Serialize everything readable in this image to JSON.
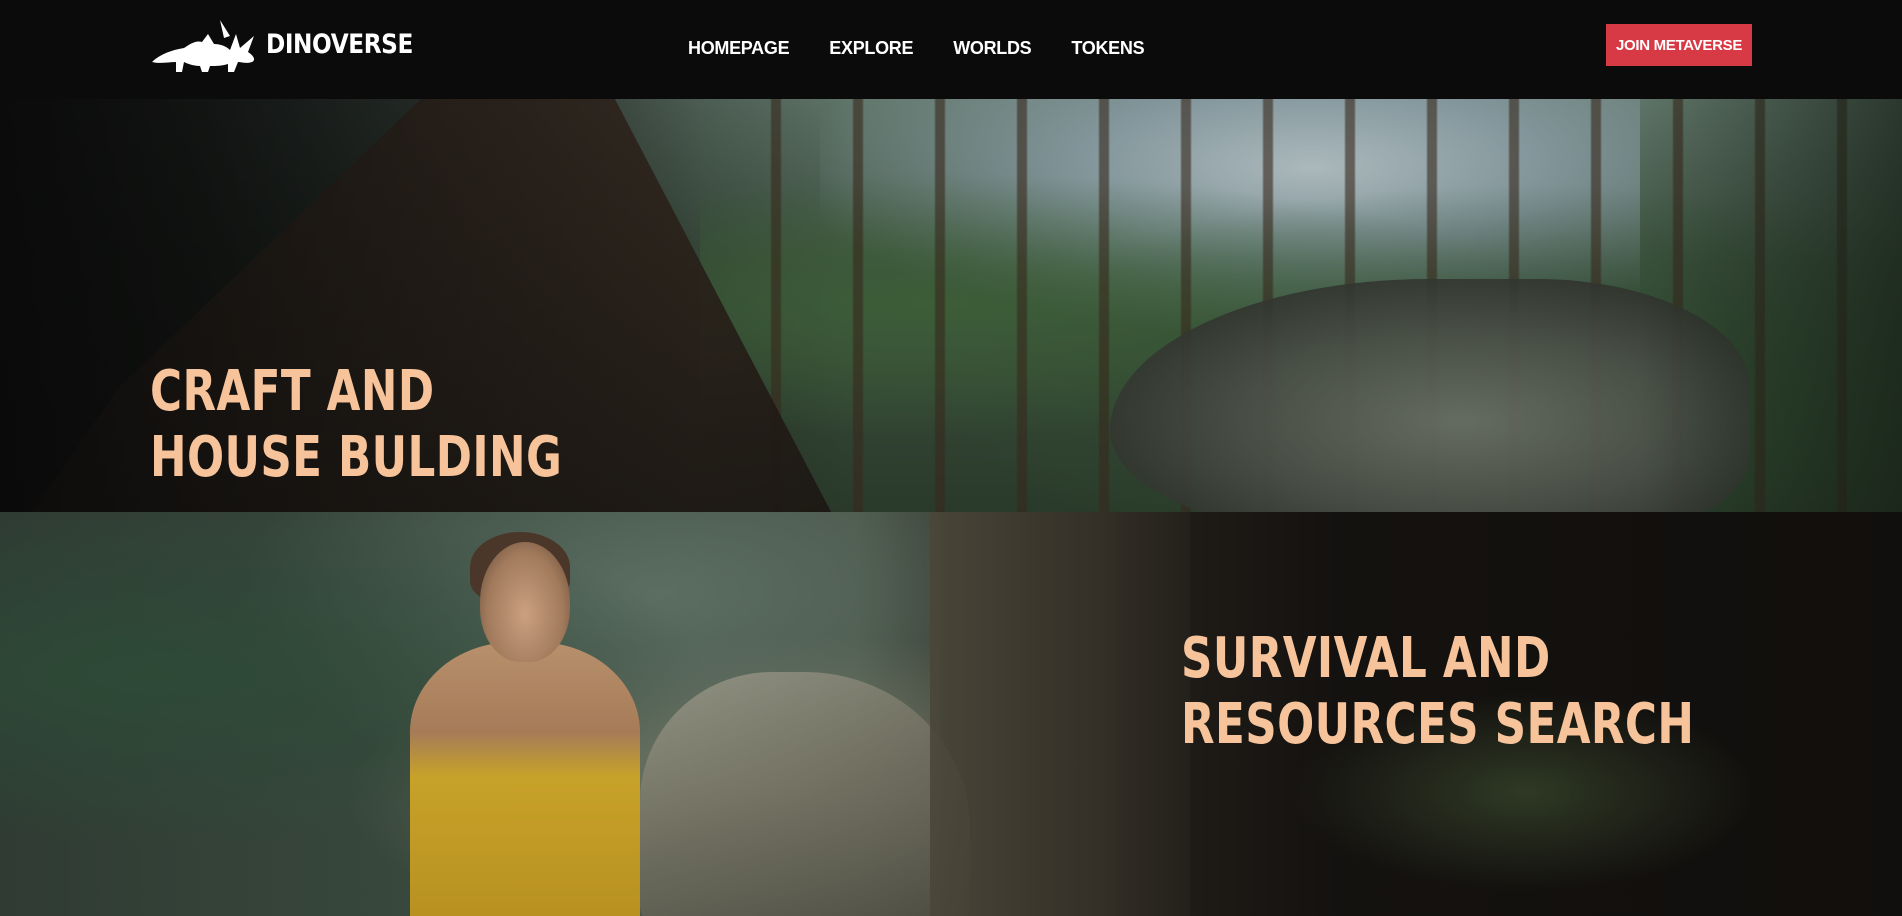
{
  "nav": {
    "brand": "DINOVERSE",
    "logo_icon": "triceratops-logo-icon",
    "menu": [
      "HOMEPAGE",
      "EXPLORE",
      "WORLDS",
      "TOKENS"
    ],
    "cta_label": "JOIN METAVERSE"
  },
  "hero1": {
    "title_line1": "CRAFT AND",
    "title_line2": "HOUSE BULDING"
  },
  "hero2": {
    "title_line1": "SURVIVAL AND",
    "title_line2": "RESOURCES SEARCH"
  },
  "colors": {
    "accent_button": "#d83a45",
    "headline": "#f6c39b",
    "nav_bg": "#0b0b0b"
  }
}
